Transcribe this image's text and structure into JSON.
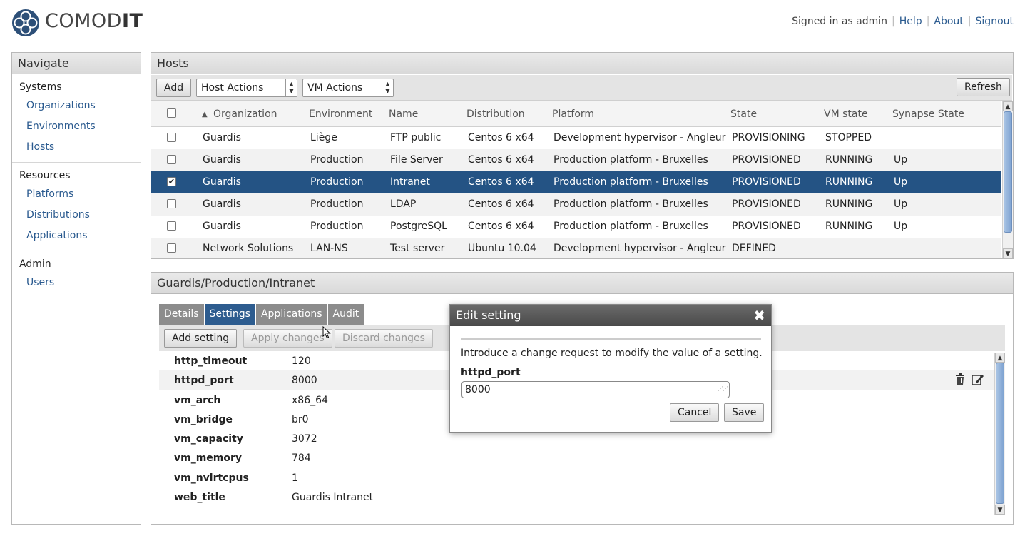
{
  "header": {
    "brand_light": "COMOD",
    "brand_bold": "IT",
    "signed_in": "Signed in as admin",
    "links": [
      "Help",
      "About",
      "Signout"
    ]
  },
  "navigate": {
    "title": "Navigate",
    "sections": [
      {
        "title": "Systems",
        "items": [
          "Organizations",
          "Environments",
          "Hosts"
        ]
      },
      {
        "title": "Resources",
        "items": [
          "Platforms",
          "Distributions",
          "Applications"
        ]
      },
      {
        "title": "Admin",
        "items": [
          "Users"
        ]
      }
    ]
  },
  "hosts": {
    "title": "Hosts",
    "add_label": "Add",
    "host_actions": "Host Actions",
    "vm_actions": "VM Actions",
    "refresh_label": "Refresh",
    "sort_indicator": "▲",
    "columns": [
      "Organization",
      "Environment",
      "Name",
      "Distribution",
      "Platform",
      "State",
      "VM state",
      "Synapse State"
    ],
    "rows": [
      {
        "checked": false,
        "selected": false,
        "cells": [
          "Guardis",
          "Liège",
          "FTP public",
          "Centos 6 x64",
          "Development hypervisor - Angleur",
          "PROVISIONING",
          "STOPPED",
          ""
        ]
      },
      {
        "checked": false,
        "selected": false,
        "cells": [
          "Guardis",
          "Production",
          "File Server",
          "Centos 6 x64",
          "Production platform - Bruxelles",
          "PROVISIONED",
          "RUNNING",
          "Up"
        ]
      },
      {
        "checked": true,
        "selected": true,
        "cells": [
          "Guardis",
          "Production",
          "Intranet",
          "Centos 6 x64",
          "Production platform - Bruxelles",
          "PROVISIONED",
          "RUNNING",
          "Up"
        ]
      },
      {
        "checked": false,
        "selected": false,
        "cells": [
          "Guardis",
          "Production",
          "LDAP",
          "Centos 6 x64",
          "Production platform - Bruxelles",
          "PROVISIONED",
          "RUNNING",
          "Up"
        ]
      },
      {
        "checked": false,
        "selected": false,
        "cells": [
          "Guardis",
          "Production",
          "PostgreSQL",
          "Centos 6 x64",
          "Production platform - Bruxelles",
          "PROVISIONED",
          "RUNNING",
          "Up"
        ]
      },
      {
        "checked": false,
        "selected": false,
        "cells": [
          "Network Solutions",
          "LAN-NS",
          "Test server",
          "Ubuntu 10.04",
          "Development hypervisor - Angleur",
          "DEFINED",
          "",
          ""
        ]
      }
    ]
  },
  "detail": {
    "title": "Guardis/Production/Intranet",
    "tabs": [
      "Details",
      "Settings",
      "Applications",
      "Audit"
    ],
    "active_tab": "Settings",
    "add_setting": "Add setting",
    "apply_changes": "Apply changes",
    "discard_changes": "Discard changes",
    "settings": [
      {
        "name": "http_timeout",
        "value": "120"
      },
      {
        "name": "httpd_port",
        "value": "8000"
      },
      {
        "name": "vm_arch",
        "value": "x86_64"
      },
      {
        "name": "vm_bridge",
        "value": "br0"
      },
      {
        "name": "vm_capacity",
        "value": "3072"
      },
      {
        "name": "vm_memory",
        "value": "784"
      },
      {
        "name": "vm_nvirtcpus",
        "value": "1"
      },
      {
        "name": "web_title",
        "value": "Guardis Intranet"
      }
    ]
  },
  "dialog": {
    "title": "Edit setting",
    "description": "Introduce a change request to modify the value of a setting.",
    "field_label": "httpd_port",
    "field_value": "8000",
    "cancel": "Cancel",
    "save": "Save"
  },
  "colors": {
    "accent": "#2d5c8f",
    "selected_row": "#245384",
    "link": "#2a5a8f"
  }
}
